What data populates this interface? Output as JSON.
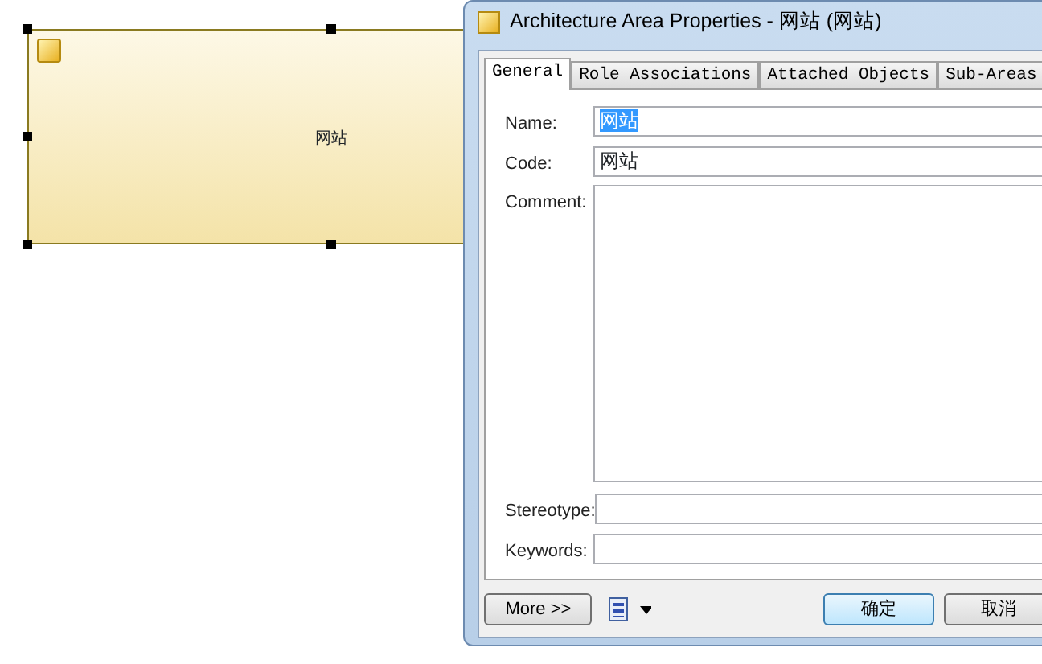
{
  "diagram": {
    "shape": {
      "label": "网站",
      "selected": true
    }
  },
  "dialog": {
    "title": "Architecture Area Properties - 网站 (网站)",
    "tabs": [
      {
        "label": "General",
        "selected": true
      },
      {
        "label": "Role Associations",
        "selected": false
      },
      {
        "label": "Attached Objects",
        "selected": false
      },
      {
        "label": "Sub-Areas",
        "selected": false
      }
    ],
    "fields": [
      {
        "label": "Name:",
        "value": "网站",
        "kind": "text",
        "text_selected": true
      },
      {
        "label": "Code:",
        "value": "网站",
        "kind": "text",
        "text_selected": false
      },
      {
        "label": "Comment:",
        "kind": "textarea"
      },
      {
        "label": "Stereotype:",
        "kind": "text"
      },
      {
        "label": "Keywords:",
        "kind": "text"
      }
    ],
    "more_button": "More >>",
    "buttons": [
      {
        "label": "确定",
        "default": true
      },
      {
        "label": "取消",
        "default": false
      }
    ]
  }
}
